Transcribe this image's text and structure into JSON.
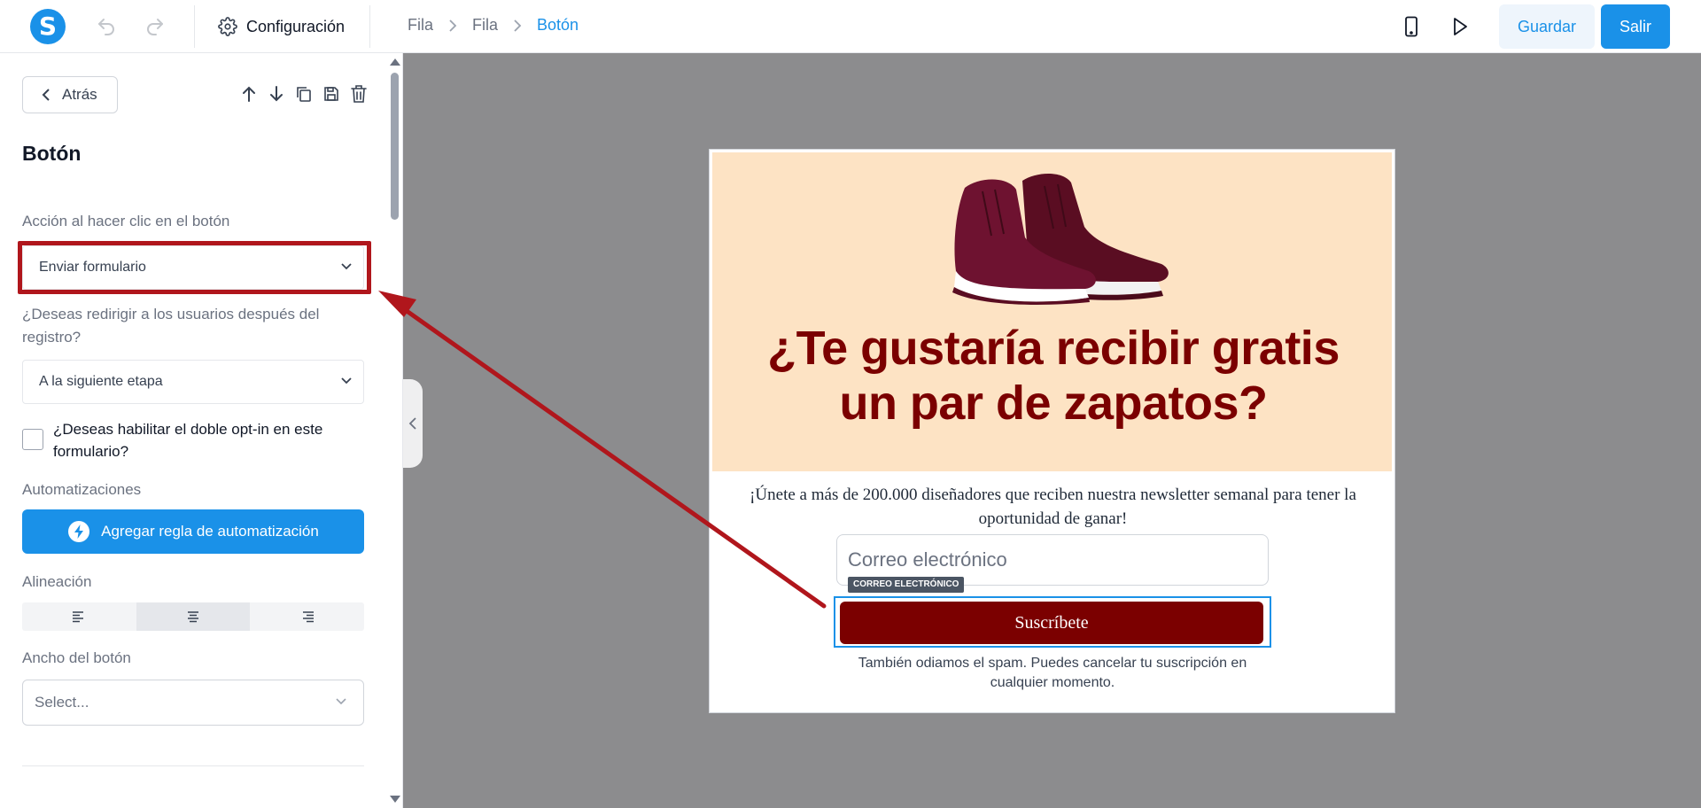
{
  "topbar": {
    "config_label": "Configuración",
    "breadcrumb": [
      "Fila",
      "Fila",
      "Botón"
    ],
    "save_label": "Guardar",
    "exit_label": "Salir"
  },
  "sidebar": {
    "back_label": "Atrás",
    "title": "Botón",
    "action_label": "Acción al hacer clic en el botón",
    "action_value": "Enviar formulario",
    "redirect_label": "¿Deseas redirigir a los usuarios después del registro?",
    "redirect_value": "A la siguiente etapa",
    "double_optin_label": "¿Deseas habilitar el doble opt-in en este formulario?",
    "automations_label": "Automatizaciones",
    "add_automation_label": "Agregar regla de automatización",
    "alignment_label": "Alineación",
    "alignment_selected": "center",
    "width_label": "Ancho del botón",
    "width_placeholder": "Select..."
  },
  "preview": {
    "headline": "¿Te gustaría recibir gratis un par de zapatos?",
    "intro": "¡Únete a más de 200.000 diseñadores que reciben nuestra newsletter semanal para tener la oportunidad de ganar!",
    "email_placeholder": "Correo electrónico",
    "email_tag": "CORREO ELECTRÓNICO",
    "button_label": "Suscríbete",
    "footnote": "También odiamos el spam. Puedes cancelar tu suscripción en cualquier momento."
  },
  "colors": {
    "accent": "#1a91e8",
    "brand_dark_red": "#7b0000",
    "hero_bg": "#fde3c4",
    "annotation_red": "#b0161c"
  }
}
